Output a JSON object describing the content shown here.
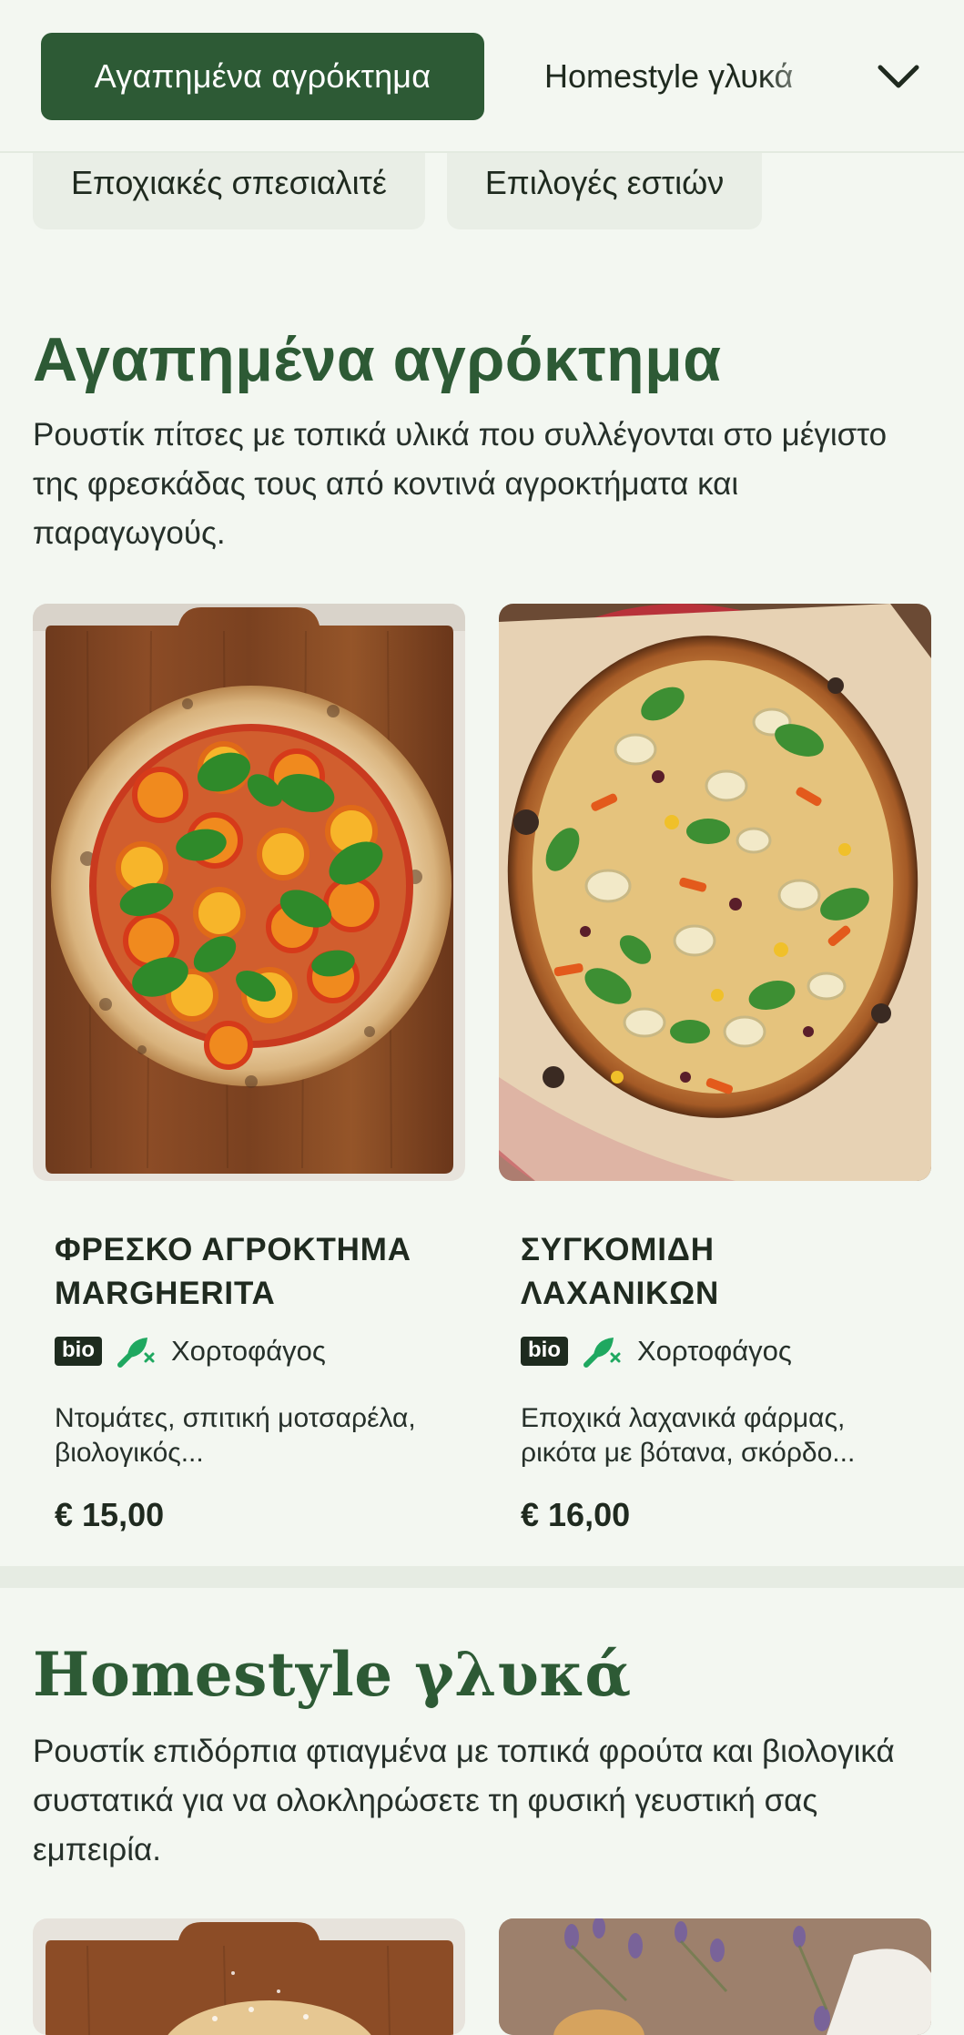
{
  "nav": {
    "active_category": "Αγαπημένα αγρόκτημα",
    "next_category": "Homestyle γλυκά",
    "chips": [
      "Εποχιακές σπεσιαλιτέ",
      "Επιλογές εστιών"
    ]
  },
  "sections": [
    {
      "title": "Αγαπημένα αγρόκτημα",
      "description": "Ρουστίκ πίτσες με τοπικά υλικά που συλλέγονται στο μέγιστο της φρεσκάδας τους από κοντινά αγροκτήματα και παραγωγούς.",
      "items": [
        {
          "name": "ΦΡΕΣΚΟ ΑΓΡΟΚΤΗΜΑ MARGHERITA",
          "badge": "bio",
          "diet": "Χορτοφάγος",
          "diet_icon": "vegetarian-icon",
          "description": "Ντομάτες, σπιτική μοτσαρέλα, βιολογικός...",
          "price": "€ 15,00"
        },
        {
          "name": "ΣΥΓΚΟΜΙΔΗ ΛΑΧΑΝΙΚΩΝ",
          "badge": "bio",
          "diet": "Χορτοφάγος",
          "diet_icon": "vegetarian-icon",
          "description": "Εποχικά λαχανικά φάρμας, ρικότα με βότανα, σκόρδο...",
          "price": "€ 16,00"
        }
      ]
    },
    {
      "title": "Homestyle γλυκά",
      "description": "Ρουστίκ επιδόρπια φτιαγμένα με τοπικά φρούτα και βιολογικά συστατικά για να ολοκληρώσετε τη φυσική γευστική σας εμπειρία."
    }
  ],
  "colors": {
    "brand_green": "#2d5a35",
    "page_bg": "#f3f7f1",
    "veg_icon": "#1fa860"
  }
}
